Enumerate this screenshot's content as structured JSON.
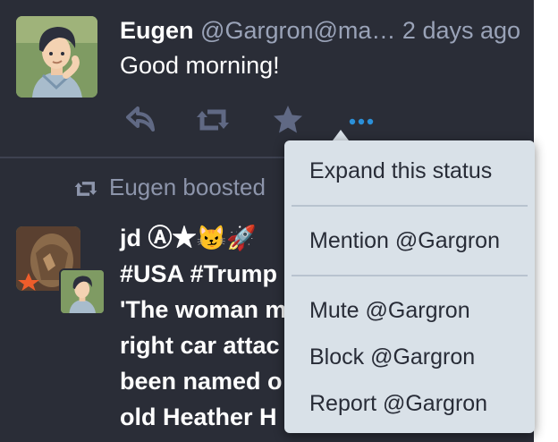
{
  "status1": {
    "display_name": "Eugen",
    "handle": "@Gargron@ma…",
    "time": "2 days ago",
    "content": "Good morning!"
  },
  "actions": [
    {
      "name": "reply-icon"
    },
    {
      "name": "boost-icon"
    },
    {
      "name": "favourite-icon"
    },
    {
      "name": "more-icon"
    }
  ],
  "boost": {
    "text": "Eugen boosted"
  },
  "status2": {
    "display_name": "jd Ⓐ★😼🚀",
    "hashtags": "#USA #Trump",
    "lines": [
      "'The woman m",
      "right car attac",
      "been named o",
      "old Heather H"
    ]
  },
  "menu": {
    "items": [
      "Expand this status",
      "Mention @Gargron",
      "Mute @Gargron",
      "Block @Gargron",
      "Report @Gargron"
    ]
  },
  "colors": {
    "background": "#2a2d37",
    "accent": "#2b90d9",
    "menu_bg": "#d9e1e8"
  }
}
